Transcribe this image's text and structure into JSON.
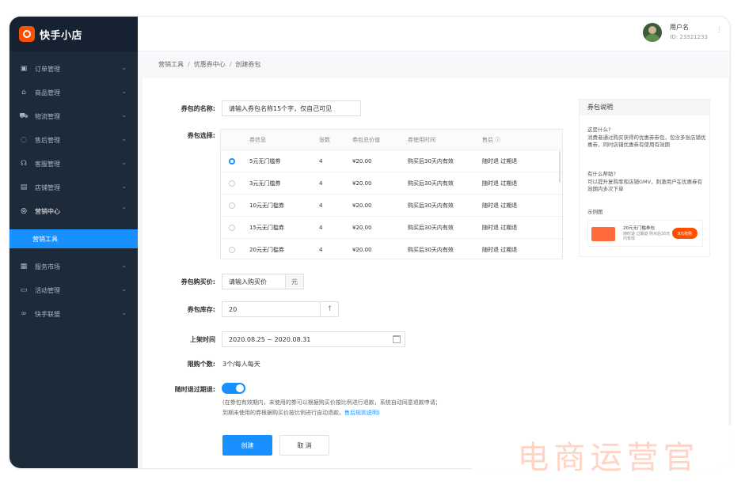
{
  "app": {
    "name": "快手小店"
  },
  "header": {
    "username": "用户名",
    "user_id": "ID: 23321233",
    "more": "⋮"
  },
  "breadcrumb": [
    "营销工具",
    "优惠券中心",
    "创建券包"
  ],
  "sidebar": {
    "items": [
      {
        "label": "订单管理",
        "icon": "▣"
      },
      {
        "label": "商品管理",
        "icon": "⌂"
      },
      {
        "label": "物流管理",
        "icon": "⛟"
      },
      {
        "label": "售后管理",
        "icon": "◌"
      },
      {
        "label": "客服管理",
        "icon": "☊"
      },
      {
        "label": "店铺管理",
        "icon": "▤"
      },
      {
        "label": "营销中心",
        "icon": "◎"
      },
      {
        "label": "服务市场",
        "icon": "▦"
      },
      {
        "label": "活动管理",
        "icon": "▭"
      },
      {
        "label": "快手联盟",
        "icon": "∞"
      }
    ],
    "active_sub": "营销工具",
    "chevron": "⌄"
  },
  "form": {
    "name_label": "券包的名称:",
    "name_placeholder": "请输入券包名称15个字，仅自己可见",
    "select_label": "券包选择:",
    "table": {
      "columns": [
        "券信息",
        "张数",
        "券包总价值",
        "券使用时间",
        "售后 ⓘ"
      ],
      "rows": [
        {
          "name": "5元无门槛券",
          "count": "4",
          "value": "¥20.00",
          "time": "购买后30天内有效",
          "after": "随时退 过期退",
          "selected": true
        },
        {
          "name": "3元无门槛券",
          "count": "4",
          "value": "¥20.00",
          "time": "购买后30天内有效",
          "after": "随时退 过期退",
          "selected": false
        },
        {
          "name": "10元无门槛券",
          "count": "4",
          "value": "¥20.00",
          "time": "购买后30天内有效",
          "after": "随时退 过期退",
          "selected": false
        },
        {
          "name": "15元无门槛券",
          "count": "4",
          "value": "¥20.00",
          "time": "购买后30天内有效",
          "after": "随时退 过期退",
          "selected": false
        },
        {
          "name": "20元无门槛券",
          "count": "4",
          "value": "¥20.00",
          "time": "购买后30天内有效",
          "after": "随时退 过期退",
          "selected": false
        }
      ]
    },
    "price_label": "券包购买价:",
    "price_placeholder": "请输入购买价",
    "price_unit": "元",
    "stock_label": "券包库存:",
    "stock_value": "20",
    "stock_arrow": "↑",
    "time_label": "上架时间",
    "time_value": "2020.08.25  ~  2020.08.31",
    "limit_label": "限购个数:",
    "limit_value": "3个/每人每天",
    "refund_label": "随时退过期退:",
    "refund_enabled": true,
    "note_line1": "(在券包有效期内，未使用的券可以根据购买价按比例进行退款，系统自动同意退款申请；",
    "note_line2": "到期未使用的券根据购买价按比例进行自动退款。",
    "note_link": "售后规则说明)",
    "create_button": "创建",
    "cancel_button": "取 消"
  },
  "side_panel": {
    "title": "券包说明",
    "q1": "这是什么?",
    "a1": "消费者通过购买获得的优惠券券包，包含多张店铺优惠券，同时店铺优惠券有使用有效期",
    "q2": "有什么帮助?",
    "a2": "可以提升复购率和店铺GMV，刺激用户在优惠券有效期内多次下单",
    "example_label": "示例图",
    "example_title": "20元无门槛券包",
    "example_sub": "随时退 过期退 购买后30天内有效",
    "example_btn": "9元抢购"
  },
  "watermark": "电商运营官"
}
